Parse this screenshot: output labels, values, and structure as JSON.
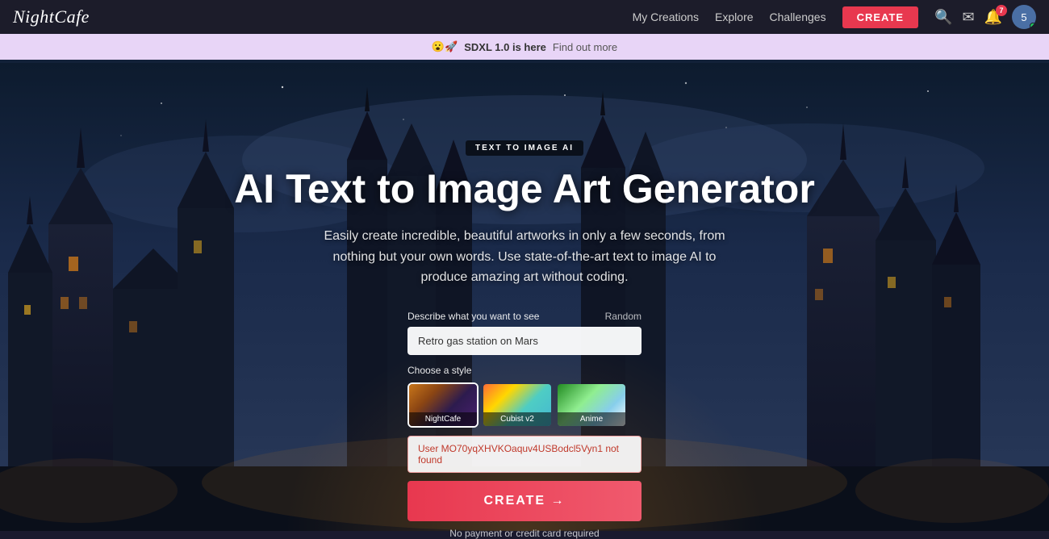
{
  "navbar": {
    "logo": "NightCafe",
    "links": [
      {
        "label": "My Creations",
        "id": "my-creations"
      },
      {
        "label": "Explore",
        "id": "explore"
      },
      {
        "label": "Challenges",
        "id": "challenges"
      }
    ],
    "create_label": "CREATE",
    "icons": {
      "search": "🔍",
      "mail": "✉",
      "bell": "🔔",
      "notifications_count": "7",
      "avatar_count": "5"
    }
  },
  "announcement": {
    "emoji": "😮🚀",
    "text": "SDXL 1.0 is here",
    "link_text": "Find out more"
  },
  "hero": {
    "tag": "TEXT TO IMAGE AI",
    "title": "AI Text to Image Art Generator",
    "subtitle": "Easily create incredible, beautiful artworks in only a few seconds, from nothing but your own words. Use state-of-the-art text to image AI to produce amazing art without coding."
  },
  "form": {
    "describe_label": "Describe what you want to see",
    "random_label": "Random",
    "input_value": "Retro gas station on Mars",
    "input_placeholder": "Retro gas station on Mars",
    "style_label": "Choose a style",
    "styles": [
      {
        "id": "nightcafe",
        "label": "NightCafe",
        "selected": true
      },
      {
        "id": "cubist",
        "label": "Cubist v2",
        "selected": false
      },
      {
        "id": "anime",
        "label": "Anime",
        "selected": false
      }
    ],
    "error_text": "User MO70yqXHVKOaquv4USBodcl5Vyn1 not found",
    "create_label": "CREATE →",
    "no_payment_text": "No payment or credit card required"
  }
}
